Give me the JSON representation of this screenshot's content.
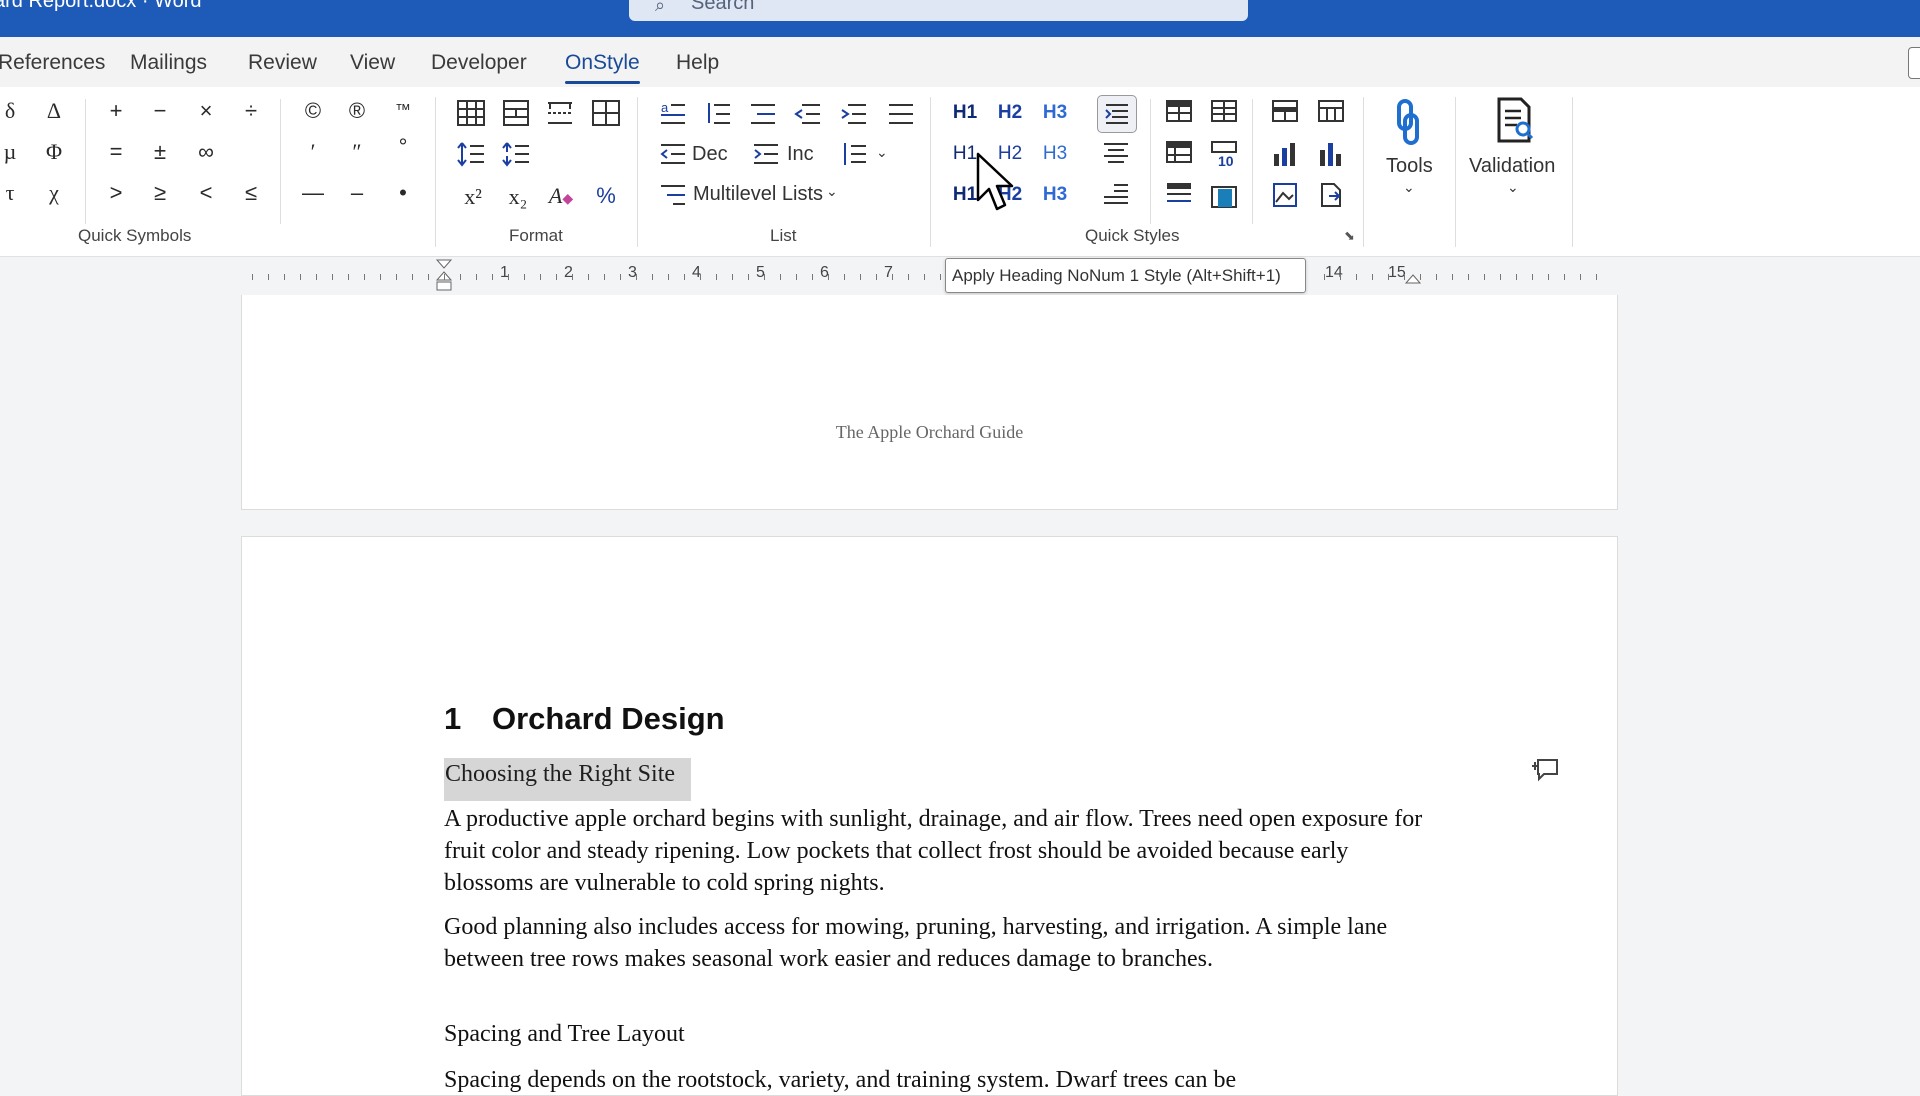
{
  "titlebar": {
    "doc_title": "ard Report.docx  ·  Word",
    "search_placeholder": "Search"
  },
  "tabs": [
    {
      "label": "References",
      "active": false
    },
    {
      "label": "Mailings",
      "active": false
    },
    {
      "label": "Review",
      "active": false
    },
    {
      "label": "View",
      "active": false
    },
    {
      "label": "Developer",
      "active": false
    },
    {
      "label": "OnStyle",
      "active": true
    },
    {
      "label": "Help",
      "active": false
    }
  ],
  "ribbon": {
    "quick_symbols": {
      "label": "Quick Symbols",
      "symbols": [
        "δ",
        "Δ",
        "+",
        "−",
        "×",
        "÷",
        "©",
        "®",
        "™",
        "µ",
        "Φ",
        "=",
        "±",
        "∞",
        "′",
        "″",
        "°",
        "τ",
        "χ",
        "&gt;",
        "≥",
        "&lt;",
        "≤",
        "—",
        "–",
        "•"
      ]
    },
    "format": {
      "label": "Format",
      "superscript": "x²",
      "subscript": "x₂"
    },
    "list": {
      "label": "List",
      "dec_label": "Dec",
      "inc_label": "Inc",
      "multilevel_label": "Multilevel Lists"
    },
    "quick_styles": {
      "label": "Quick Styles",
      "heading_buttons": [
        "H1",
        "H2",
        "H3",
        "H1",
        "H2",
        "H3",
        "H1",
        "H2",
        "H3"
      ]
    },
    "tools_label": "Tools",
    "validation_label": "Validation"
  },
  "ruler": {
    "numbers": [
      "1",
      "2",
      "3",
      "4",
      "5",
      "6",
      "7",
      "14",
      "15"
    ]
  },
  "tooltip": "Apply Heading NoNum 1 Style (Alt+Shift+1)",
  "document": {
    "header_text": "The Apple Orchard Guide",
    "heading1_number": "1",
    "heading1_text": "Orchard Design",
    "subheading1": "Choosing the Right Site",
    "para1": "A productive apple orchard begins with sunlight, drainage, and air flow. Trees need open exposure for fruit color and steady ripening. Low pockets that collect frost should be avoided because early blossoms are vulnerable to cold spring nights.",
    "para2": "Good planning also includes access for mowing, pruning, harvesting, and irrigation. A simple lane between tree rows makes seasonal work easier and reduces damage to branches.",
    "subheading2": "Spacing and Tree Layout",
    "para3": "Spacing depends on the rootstock, variety, and training system. Dwarf trees can be"
  },
  "colors": {
    "titlebar": "#1e5bb8",
    "active_tab": "#1a4a97",
    "selection": "#d6d6d6"
  }
}
